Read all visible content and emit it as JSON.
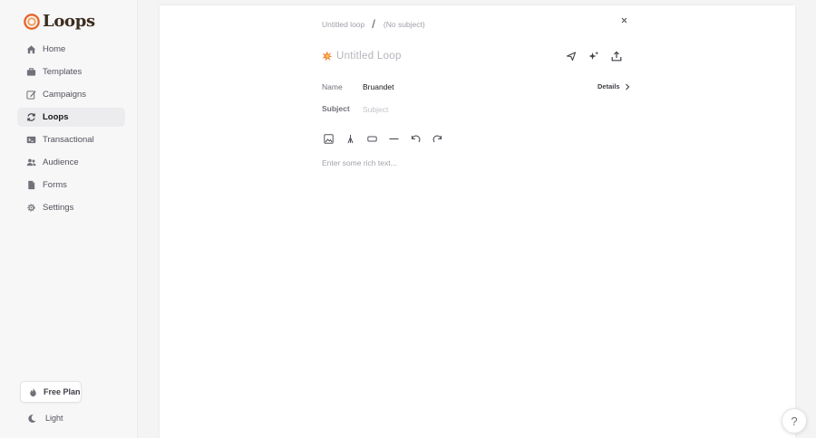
{
  "brand": {
    "name": "Loops"
  },
  "sidebar": {
    "items": [
      {
        "label": "Home",
        "icon": "home-icon",
        "active": false
      },
      {
        "label": "Templates",
        "icon": "briefcase-icon",
        "active": false
      },
      {
        "label": "Campaigns",
        "icon": "pencil-square-icon",
        "active": false
      },
      {
        "label": "Loops",
        "icon": "refresh-icon",
        "active": true
      },
      {
        "label": "Transactional",
        "icon": "terminal-icon",
        "active": false
      },
      {
        "label": "Audience",
        "icon": "users-icon",
        "active": false
      },
      {
        "label": "Forms",
        "icon": "document-icon",
        "active": false
      },
      {
        "label": "Settings",
        "icon": "gear-icon",
        "active": false
      }
    ],
    "plan_label": "Free Plan",
    "theme_label": "Light"
  },
  "editor": {
    "breadcrumb": {
      "loop": "Untitled loop",
      "separator": "/",
      "subject": "(No subject)"
    },
    "title_placeholder": "Untitled Loop",
    "fields": {
      "name_label": "Name",
      "name_value": "Bruandet",
      "subject_label": "Subject",
      "subject_placeholder": "Subject"
    },
    "details_label": "Details",
    "body_placeholder": "Enter some rich text..."
  },
  "help": {
    "label": "?"
  },
  "colors": {
    "brand_orange": "#e8652b",
    "active_bg": "#ececef"
  }
}
